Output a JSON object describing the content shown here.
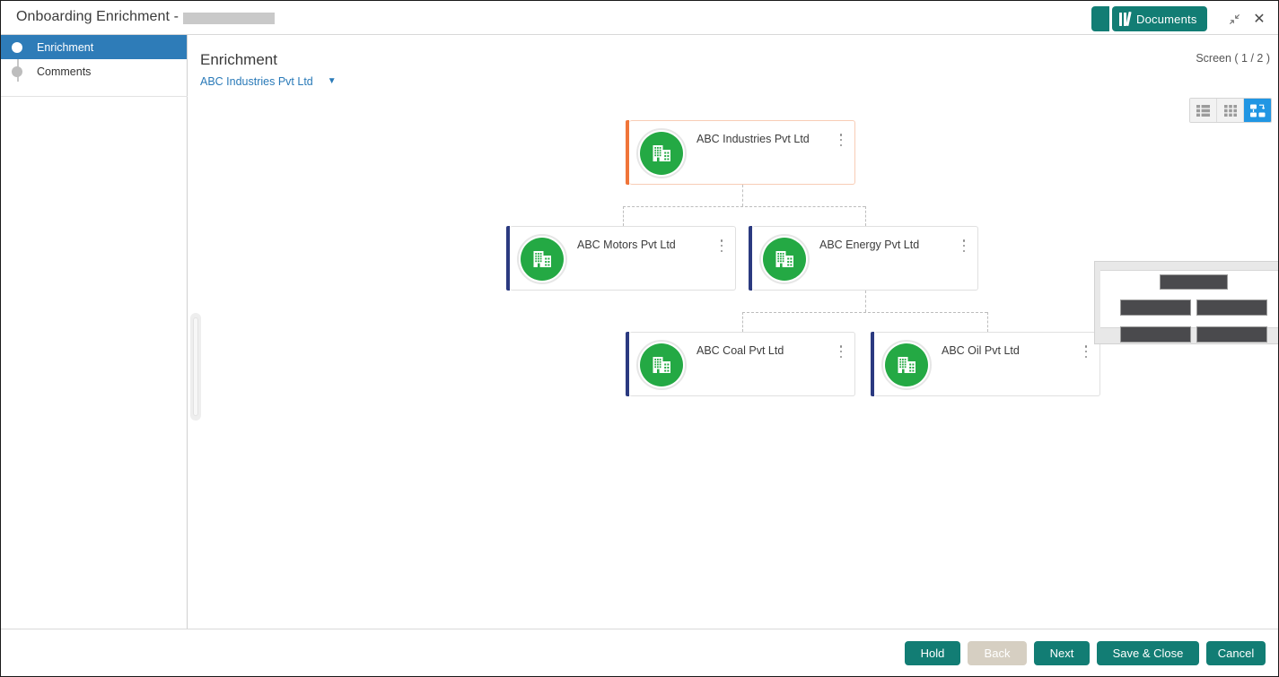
{
  "window": {
    "title": "Onboarding Enrichment - ",
    "title_redacted": true,
    "documents_button": "Documents",
    "documents_icon": "books-icon",
    "minimize_icon": "restore-down-icon",
    "close_icon": "close-icon"
  },
  "sidebar": {
    "items": [
      {
        "label": "Enrichment",
        "active": true
      },
      {
        "label": "Comments",
        "active": false
      }
    ]
  },
  "main": {
    "page_title": "Enrichment",
    "entity_selector": {
      "value": "ABC Industries Pvt Ltd",
      "chevron": "chevron-down-icon"
    },
    "screen_count": "Screen ( 1 / 2 )",
    "view_toggle": [
      {
        "name": "list-view",
        "active": false
      },
      {
        "name": "grid-view",
        "active": false
      },
      {
        "name": "tree-view",
        "active": true
      }
    ]
  },
  "tree": {
    "nodes": [
      {
        "id": "root",
        "label": "ABC Industries Pvt Ltd",
        "accent": "#f07539",
        "level": 0,
        "menu": "kebab-menu-icon",
        "icon": "building-icon"
      },
      {
        "id": "motors",
        "label": "ABC Motors Pvt Ltd",
        "accent": "#2b3a80",
        "level": 1,
        "menu": "kebab-menu-icon",
        "icon": "building-icon"
      },
      {
        "id": "energy",
        "label": "ABC Energy Pvt Ltd",
        "accent": "#2b3a80",
        "level": 1,
        "menu": "kebab-menu-icon",
        "icon": "building-icon"
      },
      {
        "id": "coal",
        "label": "ABC Coal Pvt Ltd",
        "accent": "#2b3a80",
        "level": 2,
        "menu": "kebab-menu-icon",
        "icon": "building-icon"
      },
      {
        "id": "oil",
        "label": "ABC Oil Pvt Ltd",
        "accent": "#2b3a80",
        "level": 2,
        "menu": "kebab-menu-icon",
        "icon": "building-icon"
      }
    ]
  },
  "overlay_panel": {
    "redacted": true,
    "blocks": 5
  },
  "footer": {
    "buttons": [
      {
        "label": "Hold",
        "state": "enabled"
      },
      {
        "label": "Back",
        "state": "disabled"
      },
      {
        "label": "Next",
        "state": "enabled"
      },
      {
        "label": "Save & Close",
        "state": "enabled"
      },
      {
        "label": "Cancel",
        "state": "enabled"
      }
    ]
  },
  "colors": {
    "teal": "#127d74",
    "active_blue": "#2e7cb8",
    "toggle_blue": "#2196e3",
    "green": "#24a944",
    "orange_accent": "#f07539",
    "navy_accent": "#2b3a80",
    "link_blue": "#2a7ab8"
  }
}
